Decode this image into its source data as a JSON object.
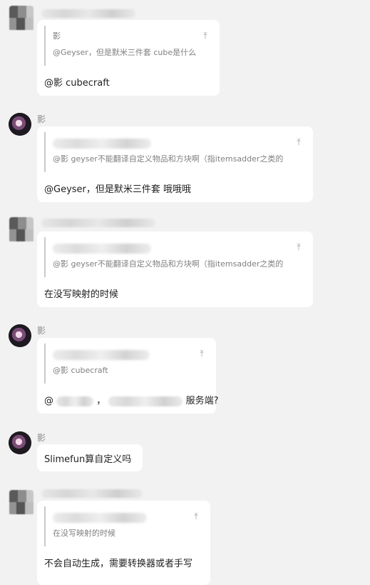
{
  "messages": [
    {
      "sender_name": "",
      "quote": {
        "name": "影",
        "text": "@Geyser，但是默米三件套 cube是什么"
      },
      "text": "@影 cubecraft"
    },
    {
      "sender_name": "影",
      "quote": {
        "name": "",
        "text": "@影 geyser不能翻译自定义物品和方块啊（指itemsadder之类的"
      },
      "text": "@Geyser，但是默米三件套 哦哦哦"
    },
    {
      "sender_name": "",
      "quote": {
        "name": "",
        "text": "@影 geyser不能翻译自定义物品和方块啊（指itemsadder之类的"
      },
      "text": "在没写映射的时候"
    },
    {
      "sender_name": "影",
      "quote": {
        "name": "",
        "text": "@影 cubecraft"
      },
      "text_prefix": "@",
      "text_mid": "，",
      "text_suffix": "服务端?"
    },
    {
      "sender_name": "影",
      "text": "Slimefun算自定义吗"
    },
    {
      "sender_name": "",
      "quote": {
        "name": "",
        "text": "在没写映射的时候"
      },
      "text": "不会自动生成，需要转换器或者手写"
    }
  ],
  "icons": {
    "jump_to_quote": "jump-to-quoted-message-icon"
  }
}
